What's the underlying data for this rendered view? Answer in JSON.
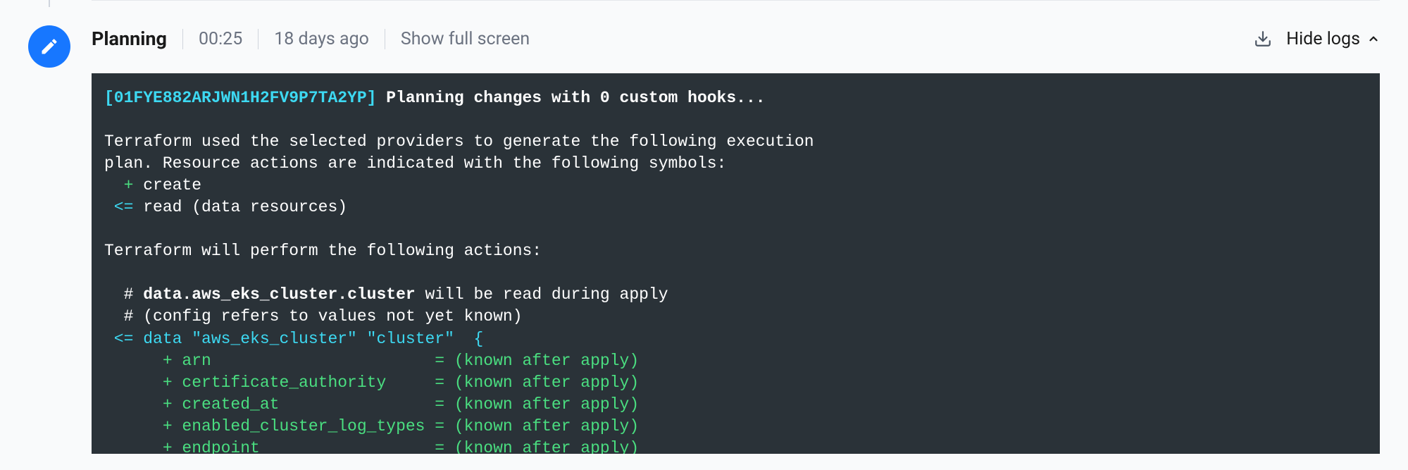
{
  "header": {
    "title": "Planning",
    "duration": "00:25",
    "timeAgo": "18 days ago",
    "showFullScreen": "Show full screen",
    "hideLogs": "Hide logs"
  },
  "terminal": {
    "runId": "[01FYE882ARJWN1H2FV9P7TA2YP]",
    "planningMsg": " Planning changes with 0 custom hooks...",
    "line1": "Terraform used the selected providers to generate the following execution",
    "line2": "plan. Resource actions are indicated with the following symbols:",
    "createSymbol": "  + ",
    "createText": "create",
    "readSymbol": " <= ",
    "readText": "read (data resources)",
    "actionsLine": "Terraform will perform the following actions:",
    "commentPrefix": "  # ",
    "resourceName": "data.aws_eks_cluster.cluster",
    "readDuring": " will be read during apply",
    "configRefers": "  # (config refers to values not yet known)",
    "dataLine": " <= data \"aws_eks_cluster\" \"cluster\"  {",
    "attr1": "      + arn                       = (known after apply)",
    "attr2": "      + certificate_authority     = (known after apply)",
    "attr3": "      + created_at                = (known after apply)",
    "attr4": "      + enabled_cluster_log_types = (known after apply)",
    "attr5": "      + endpoint                  = (known after apply)"
  }
}
